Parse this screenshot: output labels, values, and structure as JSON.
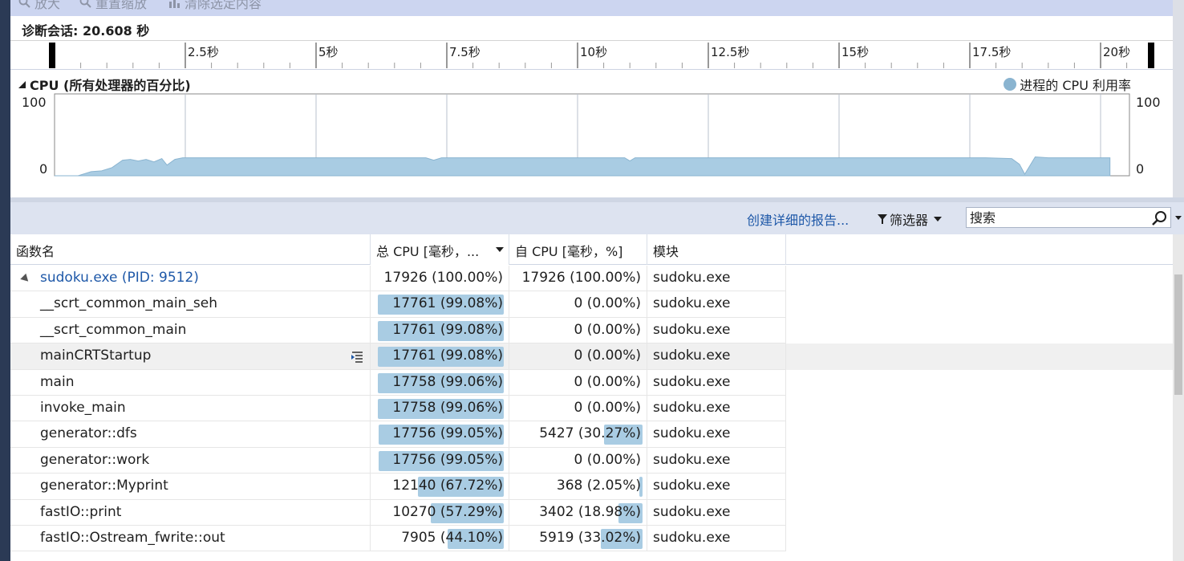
{
  "toolbar": {
    "zoom_in": "放大",
    "reset_zoom": "重置缩放",
    "clear_selection": "清除选定内容"
  },
  "session": {
    "title": "诊断会话: 20.608 秒"
  },
  "ruler": {
    "ticks": [
      "2.5秒",
      "5秒",
      "7.5秒",
      "10秒",
      "12.5秒",
      "15秒",
      "17.5秒",
      "20秒"
    ]
  },
  "cpu_graph": {
    "title": "CPU (所有处理器的百分比)",
    "legend": "进程的 CPU 利用率",
    "legend_color": "#8ab4d0",
    "y_max_label": "100",
    "y_min_label": "0",
    "series_points": [
      [
        0,
        0
      ],
      [
        0.45,
        0
      ],
      [
        0.7,
        5
      ],
      [
        0.9,
        6
      ],
      [
        1.1,
        10
      ],
      [
        1.3,
        19
      ],
      [
        1.45,
        20
      ],
      [
        1.6,
        18
      ],
      [
        1.75,
        20
      ],
      [
        1.9,
        17
      ],
      [
        2.05,
        21
      ],
      [
        2.15,
        13
      ],
      [
        2.3,
        20
      ],
      [
        2.45,
        22
      ],
      [
        2.6,
        22
      ],
      [
        5,
        22
      ],
      [
        7.1,
        22
      ],
      [
        7.25,
        19
      ],
      [
        7.4,
        22
      ],
      [
        10,
        22
      ],
      [
        10.9,
        22
      ],
      [
        11.0,
        18
      ],
      [
        11.1,
        22
      ],
      [
        11.2,
        22
      ],
      [
        12,
        22
      ],
      [
        15,
        22
      ],
      [
        17.8,
        22
      ],
      [
        18.3,
        21
      ],
      [
        18.45,
        14
      ],
      [
        18.55,
        2
      ],
      [
        18.75,
        23
      ],
      [
        19,
        22
      ],
      [
        19.5,
        22
      ],
      [
        20,
        22
      ],
      [
        20.18,
        22
      ]
    ],
    "series_color": "#a9cce3"
  },
  "filterbar": {
    "report_link": "创建详细的报告...",
    "filter_label": "筛选器",
    "search_placeholder": "搜索"
  },
  "table": {
    "columns": [
      "函数名",
      "总 CPU [毫秒，...",
      "自 CPU [毫秒，%]",
      "模块"
    ],
    "rows": [
      {
        "name": "sudoku.exe (PID: 9512)",
        "total": "17926 (100.00%)",
        "total_pct": 100.0,
        "self": "17926 (100.00%)",
        "self_pct": 100.0,
        "module": "sudoku.exe",
        "root": true
      },
      {
        "name": "__scrt_common_main_seh",
        "total": "17761 (99.08%)",
        "total_pct": 99.08,
        "self": "0 (0.00%)",
        "self_pct": 0.0,
        "module": "sudoku.exe"
      },
      {
        "name": "__scrt_common_main",
        "total": "17761 (99.08%)",
        "total_pct": 99.08,
        "self": "0 (0.00%)",
        "self_pct": 0.0,
        "module": "sudoku.exe"
      },
      {
        "name": "mainCRTStartup",
        "total": "17761 (99.08%)",
        "total_pct": 99.08,
        "self": "0 (0.00%)",
        "self_pct": 0.0,
        "module": "sudoku.exe",
        "hover": true
      },
      {
        "name": "main",
        "total": "17758 (99.06%)",
        "total_pct": 99.06,
        "self": "0 (0.00%)",
        "self_pct": 0.0,
        "module": "sudoku.exe"
      },
      {
        "name": "invoke_main",
        "total": "17758 (99.06%)",
        "total_pct": 99.06,
        "self": "0 (0.00%)",
        "self_pct": 0.0,
        "module": "sudoku.exe"
      },
      {
        "name": "generator::dfs",
        "total": "17756 (99.05%)",
        "total_pct": 99.05,
        "self": "5427 (30.27%)",
        "self_pct": 30.27,
        "module": "sudoku.exe"
      },
      {
        "name": "generator::work",
        "total": "17756 (99.05%)",
        "total_pct": 99.05,
        "self": "0 (0.00%)",
        "self_pct": 0.0,
        "module": "sudoku.exe"
      },
      {
        "name": "generator::Myprint",
        "total": "12140 (67.72%)",
        "total_pct": 67.72,
        "self": "368 (2.05%)",
        "self_pct": 2.05,
        "module": "sudoku.exe"
      },
      {
        "name": "fastIO::print",
        "total": "10270 (57.29%)",
        "total_pct": 57.29,
        "self": "3402 (18.98%)",
        "self_pct": 18.98,
        "module": "sudoku.exe"
      },
      {
        "name": "fastIO::Ostream_fwrite::out",
        "total": "7905 (44.10%)",
        "total_pct": 44.1,
        "self": "5919 (33.02%)",
        "self_pct": 33.02,
        "module": "sudoku.exe"
      }
    ]
  }
}
